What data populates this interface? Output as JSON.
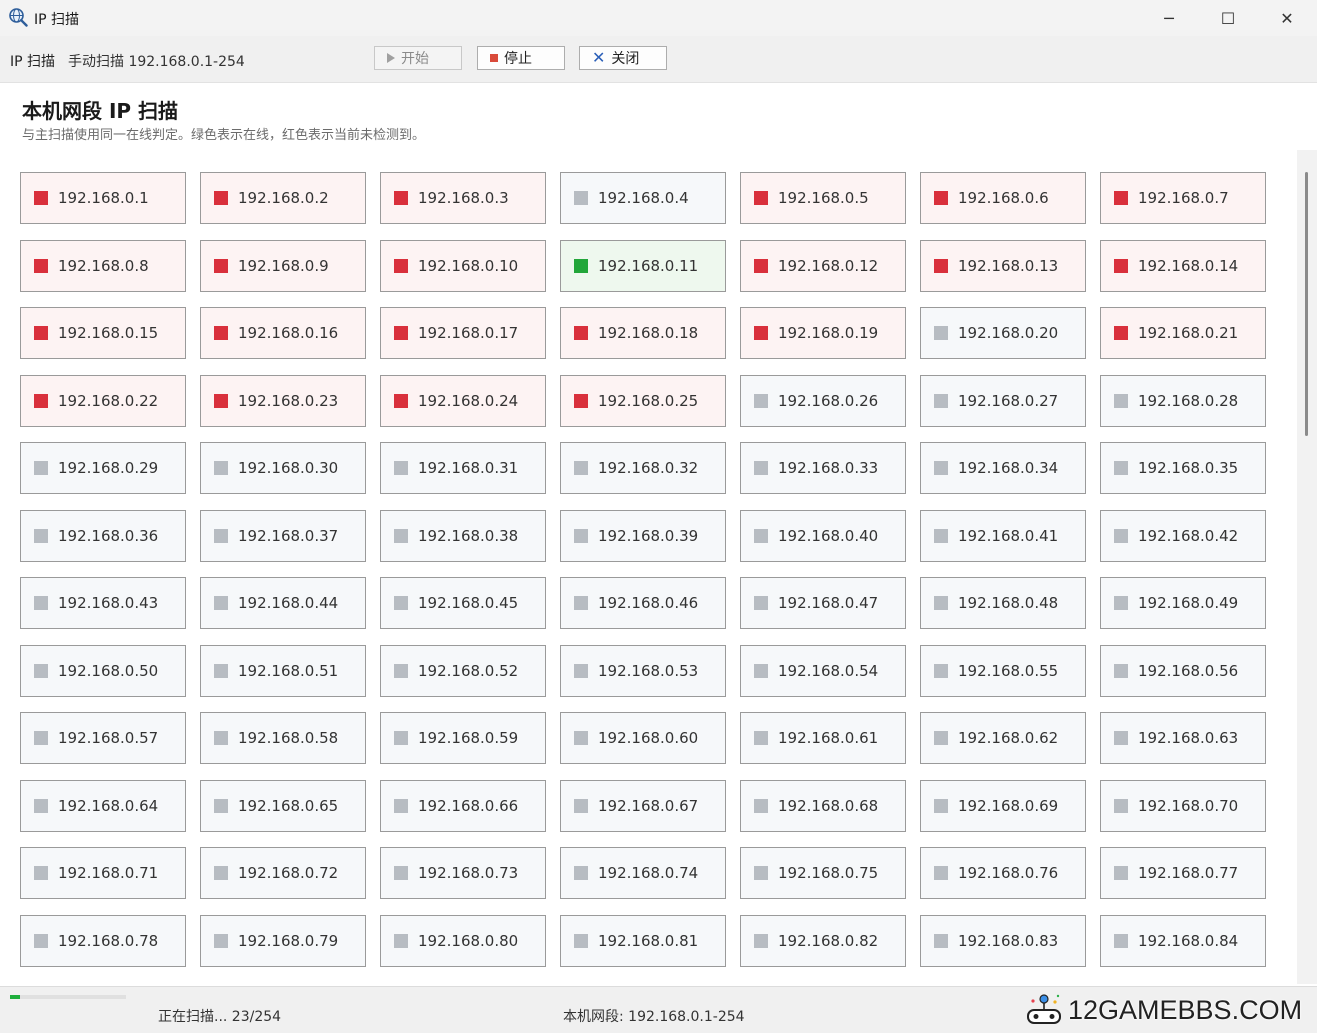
{
  "window": {
    "title": "IP 扫描",
    "icon": "magnifier-globe-icon",
    "controls": {
      "minimize": "─",
      "maximize": "☐",
      "close": "✕"
    }
  },
  "toolbar": {
    "title": "IP 扫描",
    "mode": "手动扫描 192.168.0.1-254",
    "start_label": "开始",
    "stop_label": "停止",
    "close_label": "关闭"
  },
  "header": {
    "title": "本机网段 IP 扫描",
    "subtitle": "与主扫描使用同一在线判定。绿色表示在线，红色表示当前未检测到。"
  },
  "colors": {
    "online": "#22a63a",
    "offline": "#d9303c",
    "unscanned": "#b7bcc2",
    "progress": "#1fae3c"
  },
  "hosts": [
    {
      "ip": "192.168.0.1",
      "state": "offline"
    },
    {
      "ip": "192.168.0.2",
      "state": "offline"
    },
    {
      "ip": "192.168.0.3",
      "state": "offline"
    },
    {
      "ip": "192.168.0.4",
      "state": "unknown"
    },
    {
      "ip": "192.168.0.5",
      "state": "offline"
    },
    {
      "ip": "192.168.0.6",
      "state": "offline"
    },
    {
      "ip": "192.168.0.7",
      "state": "offline"
    },
    {
      "ip": "192.168.0.8",
      "state": "offline"
    },
    {
      "ip": "192.168.0.9",
      "state": "offline"
    },
    {
      "ip": "192.168.0.10",
      "state": "offline"
    },
    {
      "ip": "192.168.0.11",
      "state": "online"
    },
    {
      "ip": "192.168.0.12",
      "state": "offline"
    },
    {
      "ip": "192.168.0.13",
      "state": "offline"
    },
    {
      "ip": "192.168.0.14",
      "state": "offline"
    },
    {
      "ip": "192.168.0.15",
      "state": "offline"
    },
    {
      "ip": "192.168.0.16",
      "state": "offline"
    },
    {
      "ip": "192.168.0.17",
      "state": "offline"
    },
    {
      "ip": "192.168.0.18",
      "state": "offline"
    },
    {
      "ip": "192.168.0.19",
      "state": "offline"
    },
    {
      "ip": "192.168.0.20",
      "state": "unknown"
    },
    {
      "ip": "192.168.0.21",
      "state": "offline"
    },
    {
      "ip": "192.168.0.22",
      "state": "offline"
    },
    {
      "ip": "192.168.0.23",
      "state": "offline"
    },
    {
      "ip": "192.168.0.24",
      "state": "offline"
    },
    {
      "ip": "192.168.0.25",
      "state": "offline"
    },
    {
      "ip": "192.168.0.26",
      "state": "unknown"
    },
    {
      "ip": "192.168.0.27",
      "state": "unknown"
    },
    {
      "ip": "192.168.0.28",
      "state": "unknown"
    },
    {
      "ip": "192.168.0.29",
      "state": "unknown"
    },
    {
      "ip": "192.168.0.30",
      "state": "unknown"
    },
    {
      "ip": "192.168.0.31",
      "state": "unknown"
    },
    {
      "ip": "192.168.0.32",
      "state": "unknown"
    },
    {
      "ip": "192.168.0.33",
      "state": "unknown"
    },
    {
      "ip": "192.168.0.34",
      "state": "unknown"
    },
    {
      "ip": "192.168.0.35",
      "state": "unknown"
    },
    {
      "ip": "192.168.0.36",
      "state": "unknown"
    },
    {
      "ip": "192.168.0.37",
      "state": "unknown"
    },
    {
      "ip": "192.168.0.38",
      "state": "unknown"
    },
    {
      "ip": "192.168.0.39",
      "state": "unknown"
    },
    {
      "ip": "192.168.0.40",
      "state": "unknown"
    },
    {
      "ip": "192.168.0.41",
      "state": "unknown"
    },
    {
      "ip": "192.168.0.42",
      "state": "unknown"
    },
    {
      "ip": "192.168.0.43",
      "state": "unknown"
    },
    {
      "ip": "192.168.0.44",
      "state": "unknown"
    },
    {
      "ip": "192.168.0.45",
      "state": "unknown"
    },
    {
      "ip": "192.168.0.46",
      "state": "unknown"
    },
    {
      "ip": "192.168.0.47",
      "state": "unknown"
    },
    {
      "ip": "192.168.0.48",
      "state": "unknown"
    },
    {
      "ip": "192.168.0.49",
      "state": "unknown"
    },
    {
      "ip": "192.168.0.50",
      "state": "unknown"
    },
    {
      "ip": "192.168.0.51",
      "state": "unknown"
    },
    {
      "ip": "192.168.0.52",
      "state": "unknown"
    },
    {
      "ip": "192.168.0.53",
      "state": "unknown"
    },
    {
      "ip": "192.168.0.54",
      "state": "unknown"
    },
    {
      "ip": "192.168.0.55",
      "state": "unknown"
    },
    {
      "ip": "192.168.0.56",
      "state": "unknown"
    },
    {
      "ip": "192.168.0.57",
      "state": "unknown"
    },
    {
      "ip": "192.168.0.58",
      "state": "unknown"
    },
    {
      "ip": "192.168.0.59",
      "state": "unknown"
    },
    {
      "ip": "192.168.0.60",
      "state": "unknown"
    },
    {
      "ip": "192.168.0.61",
      "state": "unknown"
    },
    {
      "ip": "192.168.0.62",
      "state": "unknown"
    },
    {
      "ip": "192.168.0.63",
      "state": "unknown"
    },
    {
      "ip": "192.168.0.64",
      "state": "unknown"
    },
    {
      "ip": "192.168.0.65",
      "state": "unknown"
    },
    {
      "ip": "192.168.0.66",
      "state": "unknown"
    },
    {
      "ip": "192.168.0.67",
      "state": "unknown"
    },
    {
      "ip": "192.168.0.68",
      "state": "unknown"
    },
    {
      "ip": "192.168.0.69",
      "state": "unknown"
    },
    {
      "ip": "192.168.0.70",
      "state": "unknown"
    },
    {
      "ip": "192.168.0.71",
      "state": "unknown"
    },
    {
      "ip": "192.168.0.72",
      "state": "unknown"
    },
    {
      "ip": "192.168.0.73",
      "state": "unknown"
    },
    {
      "ip": "192.168.0.74",
      "state": "unknown"
    },
    {
      "ip": "192.168.0.75",
      "state": "unknown"
    },
    {
      "ip": "192.168.0.76",
      "state": "unknown"
    },
    {
      "ip": "192.168.0.77",
      "state": "unknown"
    },
    {
      "ip": "192.168.0.78",
      "state": "unknown"
    },
    {
      "ip": "192.168.0.79",
      "state": "unknown"
    },
    {
      "ip": "192.168.0.80",
      "state": "unknown"
    },
    {
      "ip": "192.168.0.81",
      "state": "unknown"
    },
    {
      "ip": "192.168.0.82",
      "state": "unknown"
    },
    {
      "ip": "192.168.0.83",
      "state": "unknown"
    },
    {
      "ip": "192.168.0.84",
      "state": "unknown"
    }
  ],
  "status": {
    "scanning": "正在扫描... 23/254",
    "progress": 0.09,
    "segment": "本机网段: 192.168.0.1-254"
  },
  "watermark": {
    "text": "12GAMEBBS.COM",
    "logo": "game-controller-logo-icon"
  }
}
